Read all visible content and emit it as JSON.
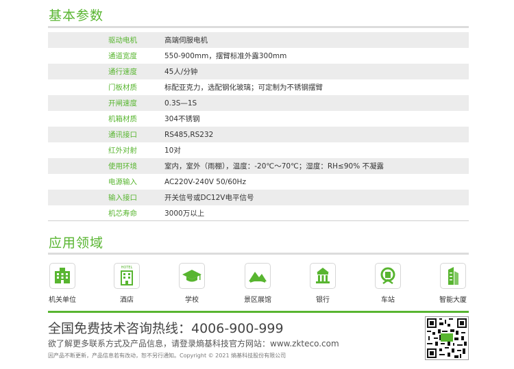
{
  "sections": {
    "params_title": "基本参数",
    "apps_title": "应用领域"
  },
  "specs": [
    {
      "label": "驱动电机",
      "value": "高端伺服电机"
    },
    {
      "label": "通道宽度",
      "value": "550-900mm，摆臂标准外露300mm"
    },
    {
      "label": "通行速度",
      "value": "45人/分钟"
    },
    {
      "label": "门板材质",
      "value": "标配亚克力，选配钢化玻璃；可定制为不锈钢摆臂"
    },
    {
      "label": "开闸速度",
      "value": "0.3S—1S"
    },
    {
      "label": "机箱材质",
      "value": "304不锈钢"
    },
    {
      "label": "通讯接口",
      "value": "RS485,RS232"
    },
    {
      "label": "红外对射",
      "value": "10对"
    },
    {
      "label": "使用环境",
      "value": "室内，室外（雨棚），温度：-20℃～70℃；湿度：RH≤90% 不凝露"
    },
    {
      "label": "电源输入",
      "value": " AC220V-240V  50/60Hz"
    },
    {
      "label": "输入接口",
      "value": "开关信号或DC12V电平信号"
    },
    {
      "label": "机芯寿命",
      "value": "3000万以上"
    }
  ],
  "applications": [
    {
      "label": "机关单位",
      "icon": "government-building-icon"
    },
    {
      "label": "酒店",
      "icon": "hotel-icon",
      "icon_text": "HOTEL"
    },
    {
      "label": "学校",
      "icon": "graduation-cap-icon"
    },
    {
      "label": "景区展馆",
      "icon": "scenic-mountain-icon"
    },
    {
      "label": "银行",
      "icon": "bank-icon"
    },
    {
      "label": "车站",
      "icon": "railway-station-icon"
    },
    {
      "label": "智能大厦",
      "icon": "smart-tower-icon"
    }
  ],
  "contact": {
    "hotline": "全国免费技术咨询热线：4006-900-999",
    "website": "欲了解更多联系方式及产品信息，请登录熵基科技官方网站：www.zkteco.com",
    "note": "因产品不断更新，产品信息若有改动，恕不另行通知。Copyright © 2021 熵基科技股份有限公司"
  },
  "colors": {
    "accent": "#58b530",
    "row_shade": "#ececec",
    "text": "#333333"
  }
}
